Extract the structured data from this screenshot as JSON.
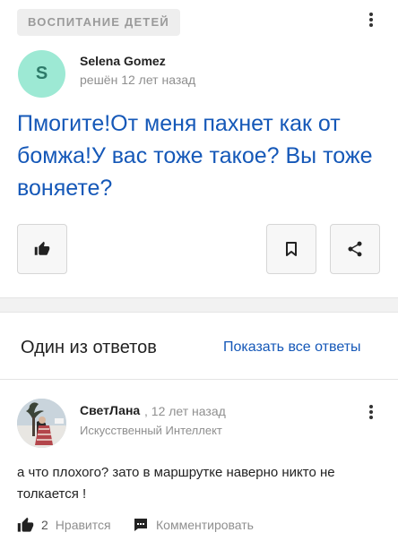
{
  "question": {
    "category": "ВОСПИТАНИЕ ДЕТЕЙ",
    "author_initial": "S",
    "author_name": "Selena Gomez",
    "meta": "решён 12 лет назад",
    "title": "Пмогите!От меня пахнет как от бомжа!У вас тоже такое? Вы тоже воняете?",
    "icons": [
      "more-vertical-icon",
      "thumbs-up-icon",
      "bookmark-icon",
      "share-icon"
    ],
    "accent_color": "#1558b8",
    "avatar_color": "#9de9d4"
  },
  "answers": {
    "heading": "Один из ответов",
    "show_all": "Показать все ответы",
    "answer": {
      "author_name": "СветЛана",
      "time": ", 12 лет назад",
      "rank": "Искусственный Интеллект",
      "text": "а что плохого? зато в маршрутке наверно никто не толкается !",
      "like_count": "2",
      "like_label": "Нравится",
      "comment_label": "Комментировать",
      "icons": [
        "more-vertical-icon",
        "thumbs-up-icon",
        "comment-icon"
      ]
    }
  }
}
